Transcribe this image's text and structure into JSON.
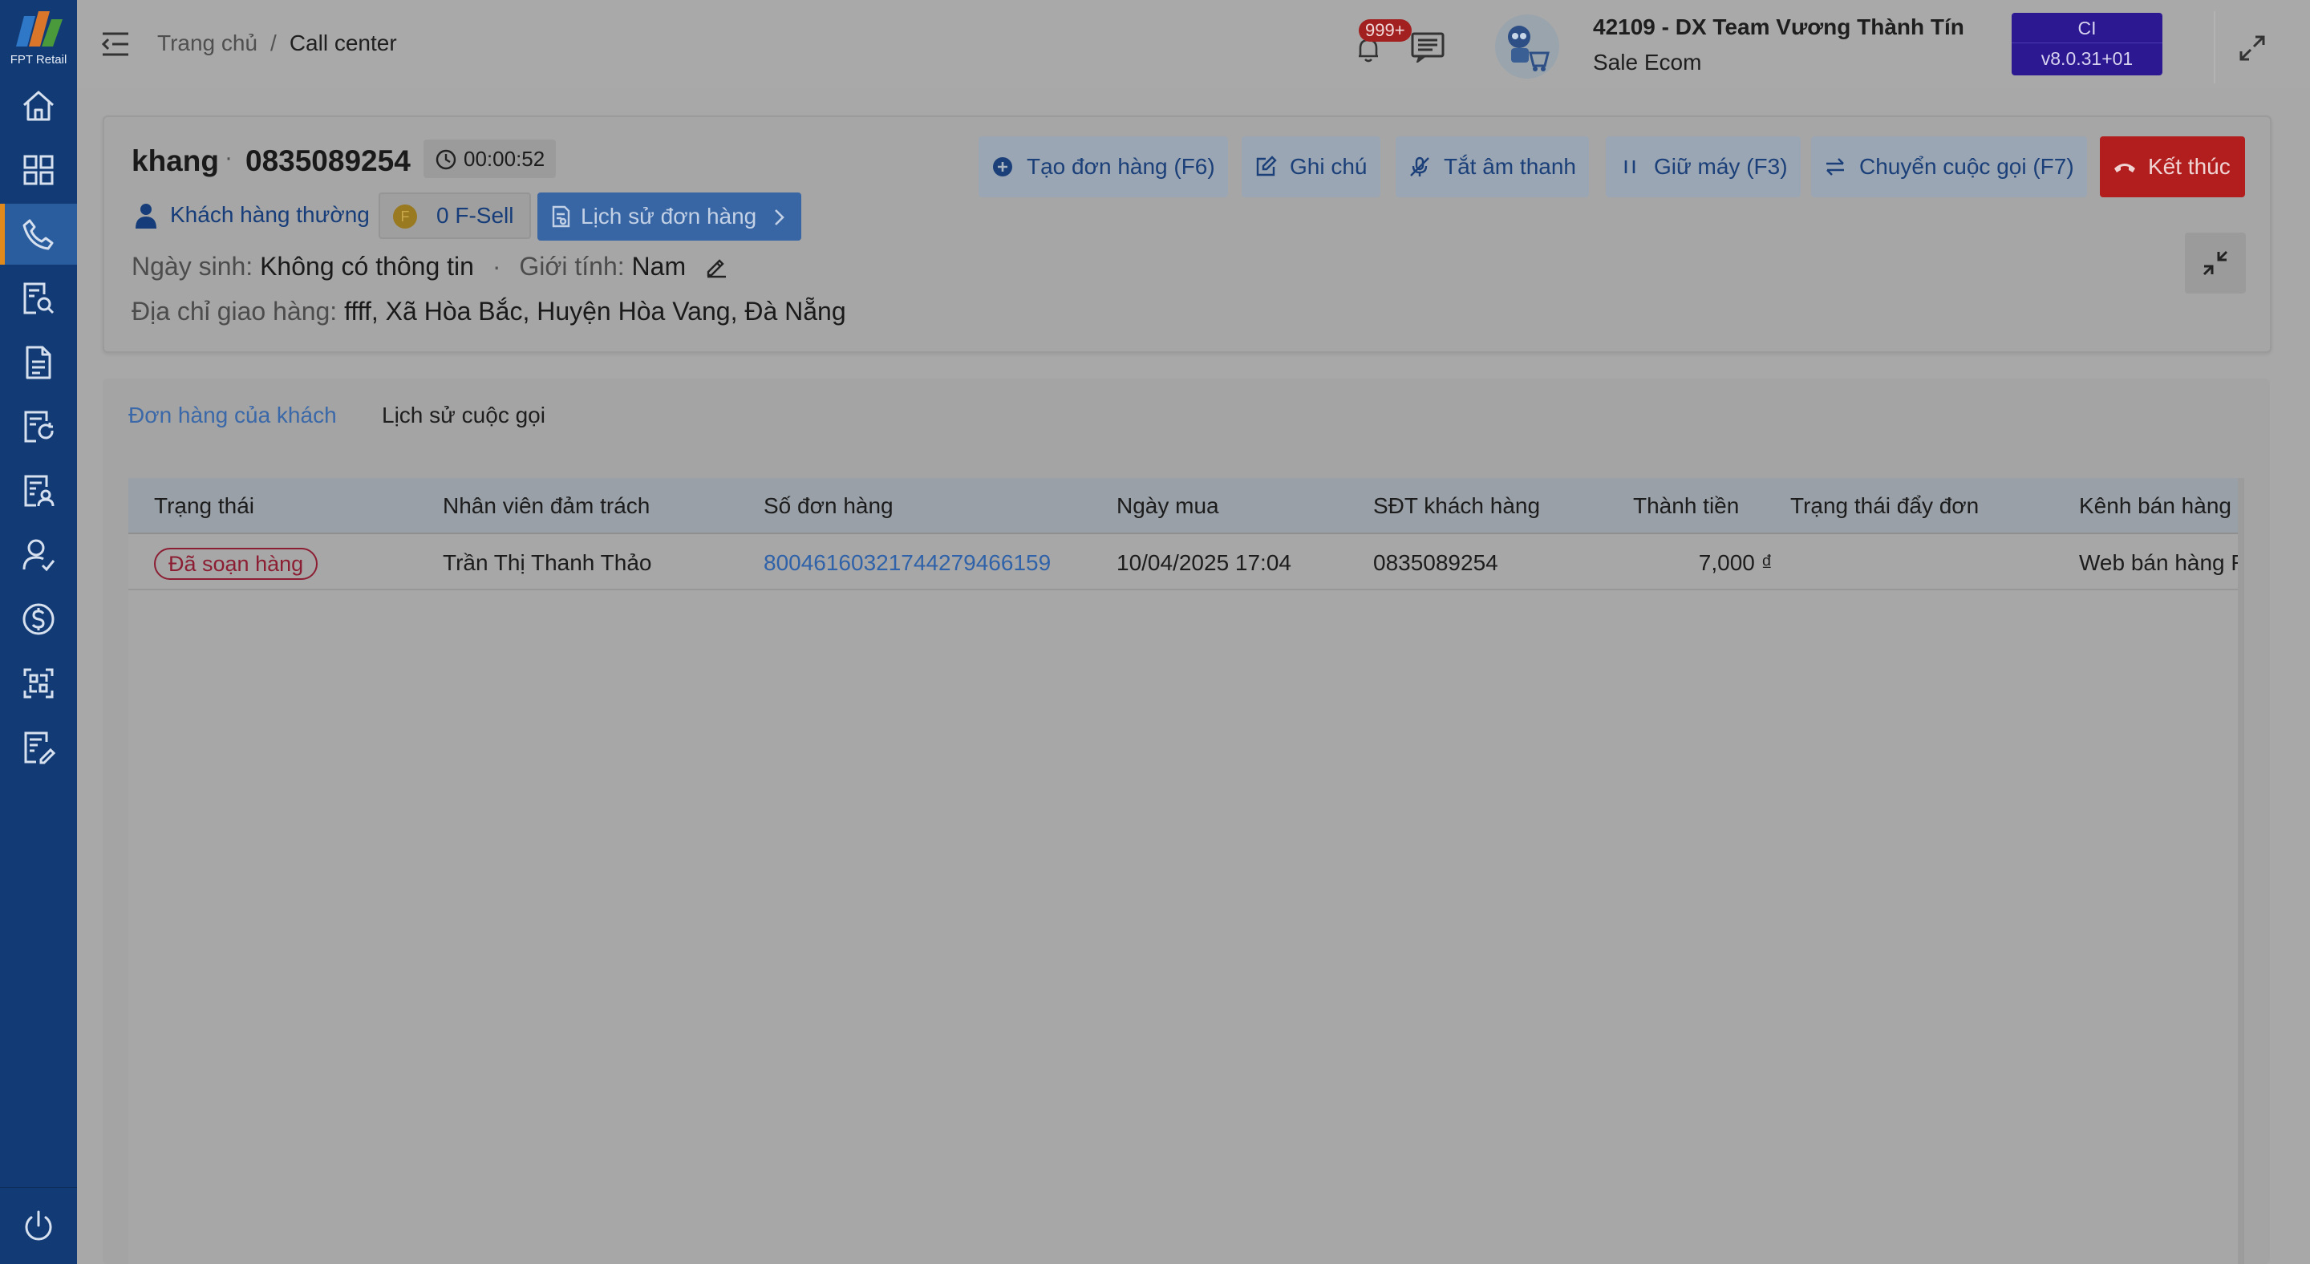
{
  "app": {
    "logo_text": "FPT Retail"
  },
  "sidebar": {
    "items": [
      {
        "icon": "home-icon"
      },
      {
        "icon": "grid-icon"
      },
      {
        "icon": "phone-icon",
        "active": true
      },
      {
        "icon": "search-document-icon"
      },
      {
        "icon": "document-icon"
      },
      {
        "icon": "document-refresh-icon"
      },
      {
        "icon": "document-user-icon"
      },
      {
        "icon": "user-check-icon"
      },
      {
        "icon": "dollar-icon"
      },
      {
        "icon": "scan-icon"
      },
      {
        "icon": "document-edit-icon"
      }
    ],
    "power_icon": "power-icon"
  },
  "header": {
    "breadcrumb": {
      "home": "Trang chủ",
      "separator": "/",
      "current": "Call center"
    },
    "notification_count": "999+",
    "user_name": "42109 - DX Team Vương Thành Tín",
    "user_role": "Sale Ecom",
    "env": {
      "name": "CI",
      "version": "v8.0.31+01"
    }
  },
  "call": {
    "customer_name": "khang",
    "separator": "·",
    "phone": "0835089254",
    "duration": "00:00:52",
    "customer_type": "Khách hàng thường",
    "fsell_coin": "F",
    "fsell": "0 F-Sell",
    "order_history_label": "Lịch sử đơn hàng",
    "birthday_label": "Ngày sinh:",
    "birthday_value": "Không có thông tin",
    "gender_label": "Giới tính:",
    "gender_value": "Nam",
    "address_label": "Địa chỉ giao hàng:",
    "address_value": "ffff, Xã Hòa Bắc, Huyện Hòa Vang, Đà Nẵng",
    "actions": {
      "create_order": "Tạo đơn hàng (F6)",
      "note": "Ghi chú",
      "mute": "Tắt âm thanh",
      "hold": "Giữ máy (F3)",
      "transfer": "Chuyển cuộc gọi (F7)",
      "end": "Kết thúc"
    }
  },
  "tabs": {
    "orders": "Đơn hàng của khách",
    "call_history": "Lịch sử cuộc gọi"
  },
  "table": {
    "columns": [
      "Trạng thái",
      "Nhân viên đảm trách",
      "Số đơn hàng",
      "Ngày mua",
      "SĐT khách hàng",
      "Thành tiền",
      "Trạng thái đẩy đơn",
      "Kênh bán hàng"
    ],
    "rows": [
      {
        "status": "Đã soạn hàng",
        "staff": "Trần Thị Thanh Thảo",
        "order_no": "8004616032174427946615​9",
        "date": "10/04/2025 17:04",
        "phone": "0835089254",
        "amount": "7,000 ₫",
        "push_status": "",
        "channel": "Web bán hàng R"
      }
    ]
  },
  "colors": {
    "sidebar": "#123b76",
    "accent_orange": "#e08a1e",
    "end_button": "#b21e1e",
    "env_badge": "#2c1891",
    "link": "#2f62a8"
  }
}
